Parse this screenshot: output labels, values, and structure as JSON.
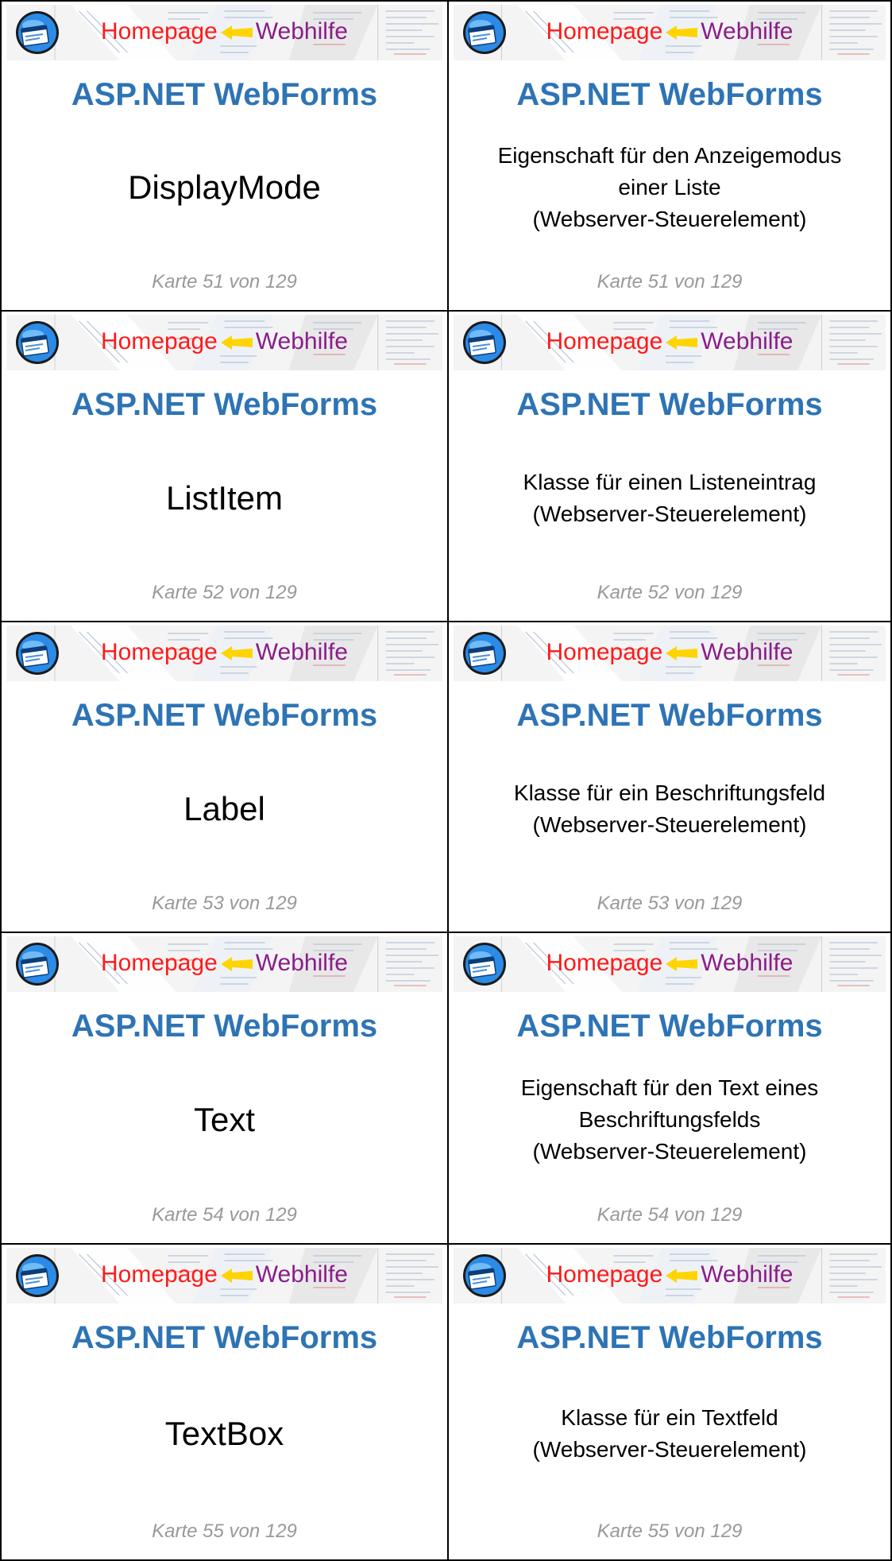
{
  "banner": {
    "home": "Homepage",
    "web": "Webhilfe"
  },
  "title": "ASP.NET WebForms",
  "cards": [
    {
      "front": {
        "term": "DisplayMode",
        "counter": "Karte 51 von 129"
      },
      "back": {
        "lines": [
          "Eigenschaft für den Anzeigemodus",
          "einer Liste",
          "(Webserver-Steuerelement)"
        ],
        "counter": "Karte 51 von 129"
      }
    },
    {
      "front": {
        "term": "ListItem",
        "counter": "Karte 52 von 129"
      },
      "back": {
        "lines": [
          "Klasse für einen Listeneintrag",
          "(Webserver-Steuerelement)"
        ],
        "counter": "Karte 52 von 129"
      }
    },
    {
      "front": {
        "term": "Label",
        "counter": "Karte 53 von 129"
      },
      "back": {
        "lines": [
          "Klasse für ein Beschriftungsfeld",
          "(Webserver-Steuerelement)"
        ],
        "counter": "Karte 53 von 129"
      }
    },
    {
      "front": {
        "term": "Text",
        "counter": "Karte 54 von 129"
      },
      "back": {
        "lines": [
          "Eigenschaft für den Text eines",
          "Beschriftungsfelds",
          "(Webserver-Steuerelement)"
        ],
        "counter": "Karte 54 von 129"
      }
    },
    {
      "front": {
        "term": "TextBox",
        "counter": "Karte 55 von 129"
      },
      "back": {
        "lines": [
          "Klasse für ein Textfeld",
          "(Webserver-Steuerelement)"
        ],
        "counter": "Karte 55 von 129"
      }
    }
  ],
  "colors": {
    "heading": "#2e74b5",
    "home": "#ff1a1a",
    "web": "#8a1d8a",
    "counter": "#999999",
    "arrow": "#ffd400"
  },
  "icons": {
    "logo": "globe-window-logo-icon",
    "arrow": "yellow-arrow-icon"
  }
}
